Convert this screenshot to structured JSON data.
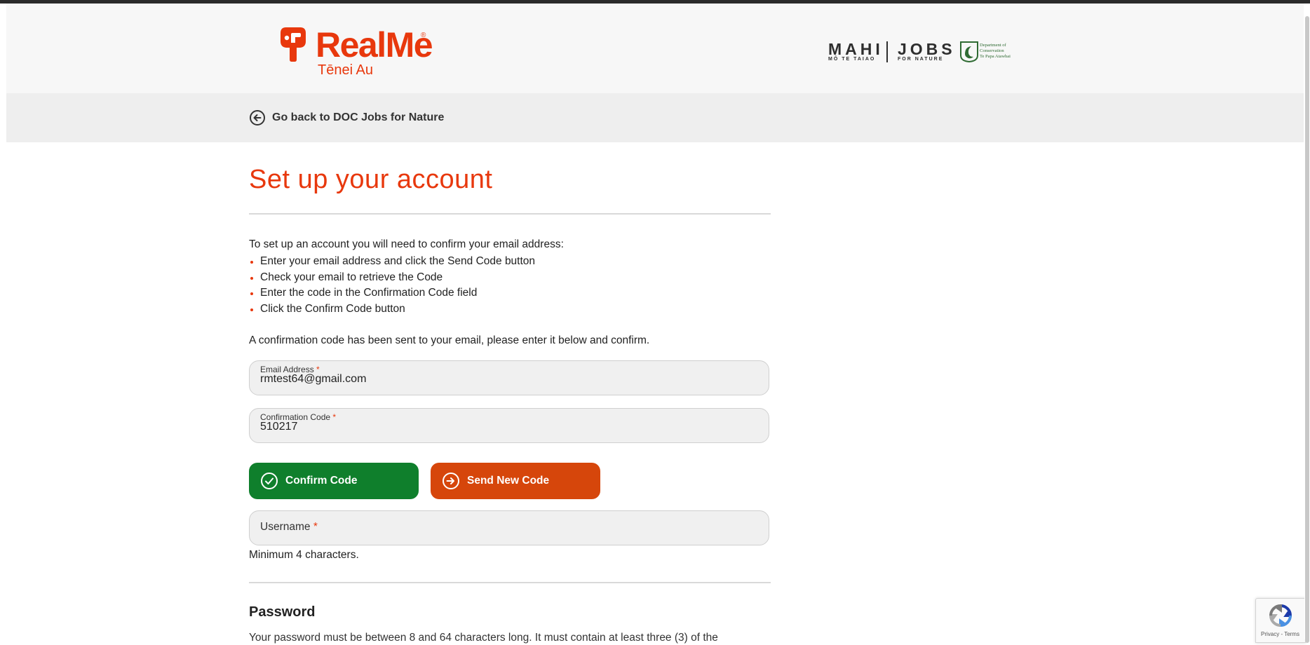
{
  "header": {
    "logo": {
      "word": "RealMe",
      "registered": "®",
      "subtitle": "Tēnei Au"
    },
    "partner": {
      "mahi": "MAHI",
      "mahi_sub": "MŌ TE TAIAO",
      "jobs": "JOBS",
      "jobs_sub": "FOR NATURE",
      "doc_lines": [
        "Department of",
        "Conservation",
        "Te Papa Atawhai"
      ]
    }
  },
  "back_link": {
    "label": "Go back to DOC Jobs for Nature"
  },
  "page": {
    "title": "Set up your account",
    "intro": "To set up an account you will need to confirm your email address:",
    "steps": [
      "Enter your email address and click the Send Code button",
      "Check your email to retrieve the Code",
      "Enter the code in the Confirmation Code field",
      "Click the Confirm Code button"
    ],
    "sent_message": "A confirmation code has been sent to your email, please enter it below and confirm."
  },
  "form": {
    "email": {
      "label": "Email Address",
      "required_mark": "*",
      "value": "rmtest64@gmail.com"
    },
    "code": {
      "label": "Confirmation Code",
      "required_mark": "*",
      "value": "510217"
    },
    "confirm_button": "Confirm Code",
    "send_button": "Send New Code",
    "username": {
      "label": "Username",
      "required_mark": "*",
      "hint": "Minimum 4 characters."
    }
  },
  "password": {
    "heading": "Password",
    "description": "Your password must be between 8 and 64 characters long. It must contain at least three (3) of the"
  },
  "recaptcha": {
    "links": "Privacy - Terms"
  },
  "colors": {
    "brand": "#e8380d",
    "confirm": "#0f7f2c",
    "send": "#d6460b"
  }
}
